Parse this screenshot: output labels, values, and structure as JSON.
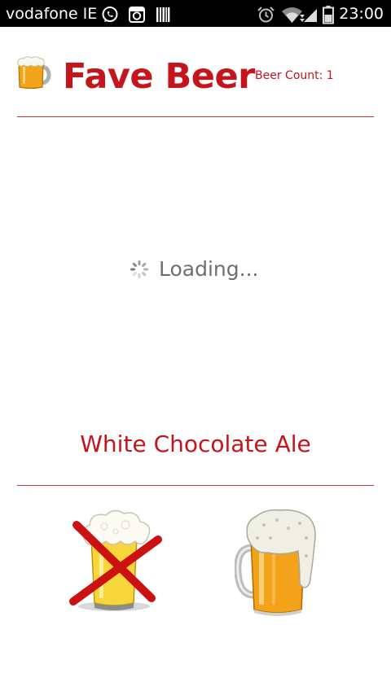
{
  "status_bar": {
    "carrier": "vodafone IE",
    "time": "23:00",
    "icons": [
      "whatsapp-icon",
      "instagram-icon",
      "barcode-icon",
      "alarm-icon",
      "wifi-icon",
      "signal-icon",
      "battery-icon"
    ]
  },
  "header": {
    "title": "Fave Beer",
    "beer_count": "Beer Count: 1",
    "icon": "beer-mug-icon"
  },
  "content": {
    "loading_text": "Loading...",
    "beer_name": "White Chocolate Ale"
  },
  "actions": {
    "dislike_icon": "beer-crossed-out-icon",
    "like_icon": "beer-mug-icon"
  },
  "colors": {
    "accent": "#c4151c",
    "status_bar_bg": "#000000",
    "loading_text": "#6f6f6f"
  }
}
